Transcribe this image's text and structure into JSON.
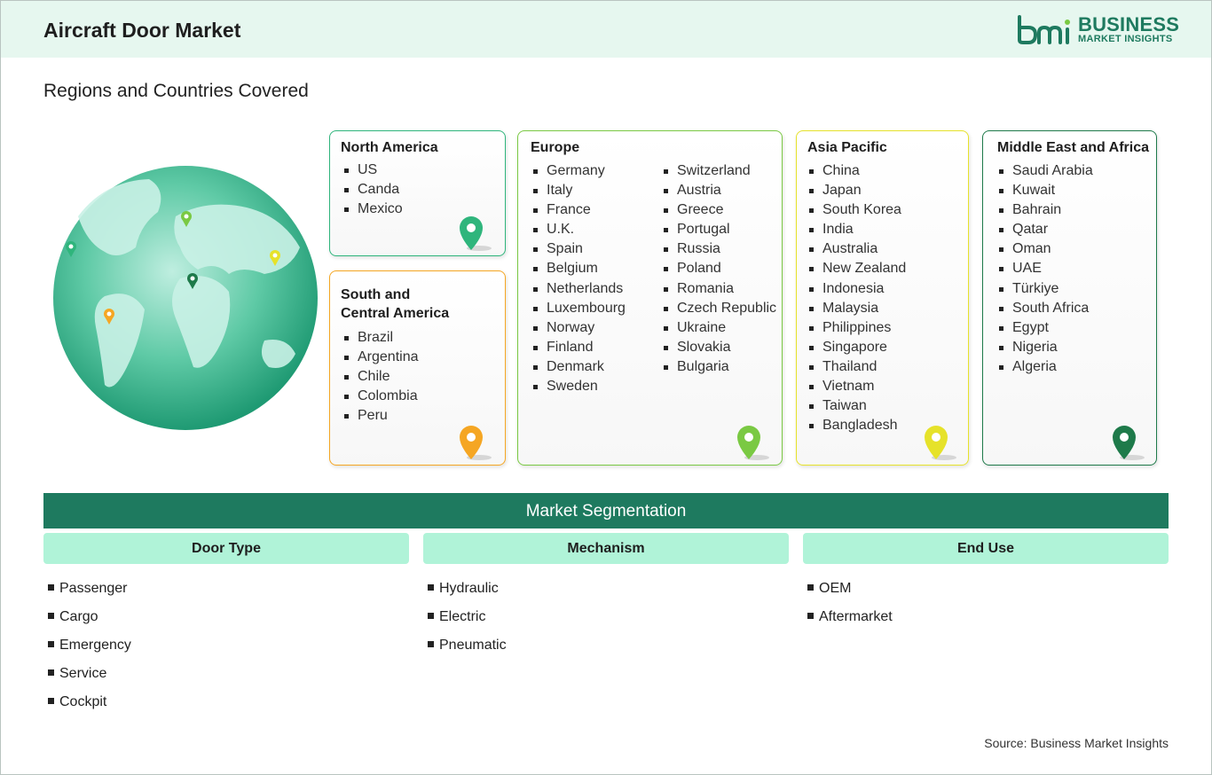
{
  "header": {
    "title": "Aircraft Door Market",
    "logo_word1": "BUSINESS",
    "logo_word2": "MARKET INSIGHTS"
  },
  "subtitle": "Regions and Countries Covered",
  "regions": {
    "north_america": {
      "title": "North America",
      "countries": [
        "US",
        "Canda",
        "Mexico"
      ],
      "pin_color": "#2fb57c"
    },
    "south_central_america": {
      "title_line1": "South and",
      "title_line2": "Central America",
      "countries": [
        "Brazil",
        "Argentina",
        "Chile",
        "Colombia",
        "Peru"
      ],
      "pin_color": "#f5a623"
    },
    "europe": {
      "title": "Europe",
      "countries_col1": [
        "Germany",
        "Italy",
        "France",
        "U.K.",
        "Spain",
        "Belgium",
        "Netherlands",
        "Luxembourg",
        "Norway",
        "Finland",
        "Denmark",
        "Sweden"
      ],
      "countries_col2": [
        "Switzerland",
        "Austria",
        "Greece",
        "Portugal",
        "Russia",
        "Poland",
        "Romania",
        "Czech Republic",
        "Ukraine",
        "Slovakia",
        "Bulgaria"
      ],
      "pin_color": "#7ac943"
    },
    "asia_pacific": {
      "title": "Asia Pacific",
      "countries": [
        "China",
        "Japan",
        "South Korea",
        "India",
        "Australia",
        "New Zealand",
        "Indonesia",
        "Malaysia",
        "Philippines",
        "Singapore",
        "Thailand",
        "Vietnam",
        "Taiwan",
        "Bangladesh"
      ],
      "pin_color": "#e6e22a"
    },
    "middle_east_africa": {
      "title": "Middle East and Africa",
      "countries": [
        "Saudi Arabia",
        "Kuwait",
        "Bahrain",
        "Qatar",
        "Oman",
        "UAE",
        "Türkiye",
        "South Africa",
        "Egypt",
        "Nigeria",
        "Algeria"
      ],
      "pin_color": "#1e7a4a"
    }
  },
  "segmentation": {
    "title": "Market Segmentation",
    "columns": [
      {
        "heading": "Door Type",
        "items": [
          "Passenger",
          "Cargo",
          "Emergency",
          "Service",
          "Cockpit"
        ]
      },
      {
        "heading": "Mechanism",
        "items": [
          "Hydraulic",
          "Electric",
          "Pneumatic"
        ]
      },
      {
        "heading": "End Use",
        "items": [
          "OEM",
          "Aftermarket"
        ]
      }
    ]
  },
  "source": "Source: Business Market Insights",
  "colors": {
    "brand": "#1e7a5f",
    "header_bg": "#e6f7ef",
    "segment_head_bg": "#b0f3d8"
  }
}
